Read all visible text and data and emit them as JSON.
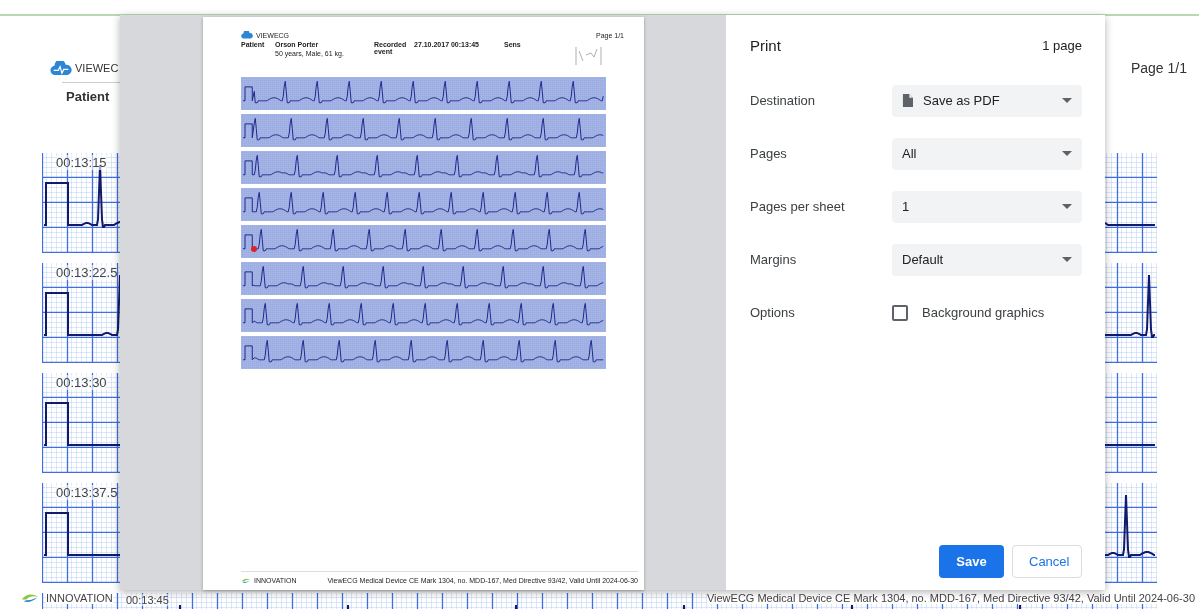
{
  "background_page": {
    "logo": "VIEWEC",
    "page_label": "Page 1/1",
    "patient_label": "Patient",
    "strips": [
      {
        "time": "00:13:15"
      },
      {
        "time": "00:13:22.5"
      },
      {
        "time": "00:13:30"
      },
      {
        "time": "00:13:37.5"
      },
      {
        "time": "00:13:45"
      }
    ],
    "footer_left": "INNOVATION",
    "footer_right": "ViewECG Medical Device CE Mark 1304, no. MDD-167, Med Directive 93/42, Valid Until 2024-06-30"
  },
  "print_preview": {
    "logo": "VIEWECG",
    "page_label": "Page 1/1",
    "patient_label": "Patient",
    "patient_name": "Orson Porter",
    "patient_details": "50 years, Male, 61 kg.",
    "event_label": "Recorded event",
    "event_time": "27.10.2017 00:13:45",
    "sensor_label": "Sens",
    "strips": [
      {
        "marker": false
      },
      {
        "marker": false
      },
      {
        "marker": false
      },
      {
        "marker": false
      },
      {
        "marker": true
      },
      {
        "marker": false
      },
      {
        "marker": false
      },
      {
        "marker": false
      }
    ],
    "footer_left": "INNOVATION",
    "footer_right": "ViewECG Medical Device CE Mark 1304, no. MDD-167, Med Directive 93/42, Valid Until 2024-06-30"
  },
  "print_settings": {
    "title": "Print",
    "page_count": "1 page",
    "rows": [
      {
        "kind": "file",
        "label": "Destination",
        "value": "Save as PDF"
      },
      {
        "kind": "select",
        "label": "Pages",
        "value": "All"
      },
      {
        "kind": "select",
        "label": "Pages per sheet",
        "value": "1"
      },
      {
        "kind": "select",
        "label": "Margins",
        "value": "Default"
      },
      {
        "kind": "checkbox",
        "label": "Options",
        "value": "Background graphics",
        "checked": false
      }
    ],
    "buttons": [
      {
        "kind": "primary",
        "label": "Save"
      },
      {
        "kind": "secondary",
        "label": "Cancel"
      }
    ]
  }
}
